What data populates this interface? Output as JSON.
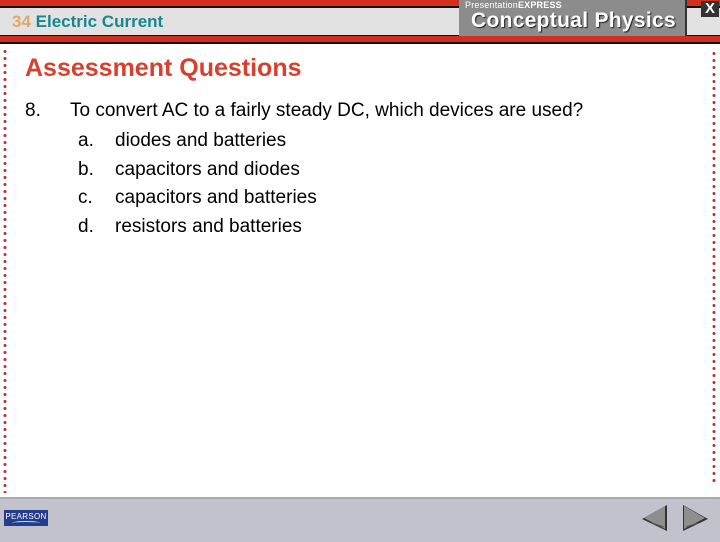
{
  "header": {
    "chapter_number": "34",
    "chapter_title": "Electric Current",
    "brand_sub_light": "Presentation",
    "brand_sub_bold": "EXPRESS",
    "brand_main": "Conceptual Physics",
    "close_label": "X"
  },
  "slide": {
    "title": "Assessment Questions",
    "question_number": "8.",
    "question_text": "To convert AC to a fairly steady DC, which devices are used?",
    "options": [
      {
        "label": "a.",
        "text": "diodes and batteries"
      },
      {
        "label": "b.",
        "text": "capacitors and diodes"
      },
      {
        "label": "c.",
        "text": "capacitors and batteries"
      },
      {
        "label": "d.",
        "text": "resistors and batteries"
      }
    ]
  },
  "footer": {
    "logo_text": "PEARSON",
    "prev_icon": "triangle-left",
    "next_icon": "triangle-right"
  },
  "colors": {
    "accent_red": "#d0301e",
    "title_red": "#d8402e",
    "chapter_teal": "#16888e",
    "chapter_number_orange": "#e3a868",
    "pearson_blue": "#233c8c"
  }
}
